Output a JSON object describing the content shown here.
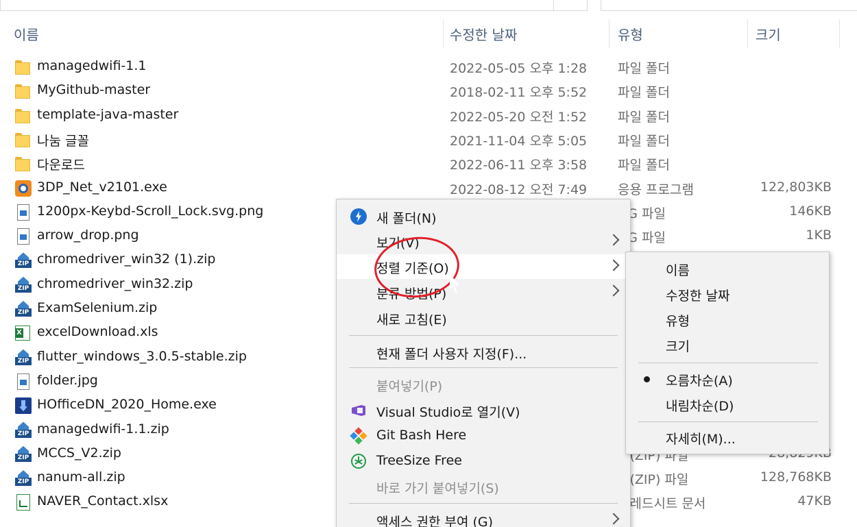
{
  "columns": {
    "name": "이름",
    "date": "수정한 날짜",
    "type": "유형",
    "size": "크기"
  },
  "files": [
    {
      "icon": "folder-icon",
      "name": "managedwifi-1.1",
      "date": "2022-05-05 오후 1:28",
      "type": "파일 폴더",
      "size": ""
    },
    {
      "icon": "folder-icon",
      "name": "MyGithub-master",
      "date": "2018-02-11 오후 5:52",
      "type": "파일 폴더",
      "size": ""
    },
    {
      "icon": "folder-icon",
      "name": "template-java-master",
      "date": "2022-05-20 오전 1:52",
      "type": "파일 폴더",
      "size": ""
    },
    {
      "icon": "folder-icon",
      "name": "나눔 글꼴",
      "date": "2021-11-04 오후 5:05",
      "type": "파일 폴더",
      "size": ""
    },
    {
      "icon": "folder-icon",
      "name": "다운로드",
      "date": "2022-06-11 오후 3:58",
      "type": "파일 폴더",
      "size": ""
    },
    {
      "icon": "exe-3dp-icon",
      "name": "3DP_Net_v2101.exe",
      "date": "2022-08-12 오전 7:49",
      "type": "응용 프로그램",
      "size": "122,803KB"
    },
    {
      "icon": "png-file-icon",
      "name": "1200px-Keybd-Scroll_Lock.svg.png",
      "date": "",
      "type": "NG 파일",
      "size": "146KB"
    },
    {
      "icon": "png-file-icon",
      "name": "arrow_drop.png",
      "date": "",
      "type": "NG 파일",
      "size": "1KB"
    },
    {
      "icon": "zip-file-icon",
      "name": "chromedriver_win32 (1).zip",
      "date": "",
      "type": "",
      "size": ""
    },
    {
      "icon": "zip-file-icon",
      "name": "chromedriver_win32.zip",
      "date": "",
      "type": "",
      "size": ""
    },
    {
      "icon": "zip-file-icon",
      "name": "ExamSelenium.zip",
      "date": "",
      "type": "",
      "size": ""
    },
    {
      "icon": "xls-file-icon",
      "name": "excelDownload.xls",
      "date": "",
      "type": "",
      "size": ""
    },
    {
      "icon": "zip-file-icon",
      "name": "flutter_windows_3.0.5-stable.zip",
      "date": "",
      "type": "",
      "size": ""
    },
    {
      "icon": "jpg-file-icon",
      "name": "folder.jpg",
      "date": "",
      "type": "",
      "size": ""
    },
    {
      "icon": "hoffice-installer-icon",
      "name": "HOfficeDN_2020_Home.exe",
      "date": "",
      "type": "",
      "size": ""
    },
    {
      "icon": "zip-file-icon",
      "name": "managedwifi-1.1.zip",
      "date": "",
      "type": "",
      "size": ""
    },
    {
      "icon": "zip-file-icon",
      "name": "MCCS_V2.zip",
      "date": "",
      "type": "축(ZIP) 파일",
      "size": "28,829KB"
    },
    {
      "icon": "zip-file-icon",
      "name": "nanum-all.zip",
      "date": "",
      "type": "축(ZIP) 파일",
      "size": "128,768KB"
    },
    {
      "icon": "xlsx-file-icon",
      "name": "NAVER_Contact.xlsx",
      "date": "",
      "type": "프레드시트 문서",
      "size": "47KB"
    }
  ],
  "context_menu": {
    "items": [
      {
        "key": "new-folder",
        "label": "새 폴더(N)",
        "icon": "new-folder-icon",
        "submenu": false,
        "disabled": false
      },
      {
        "key": "view",
        "label": "보기(V)",
        "icon": "",
        "submenu": true,
        "disabled": false
      },
      {
        "key": "sort-by",
        "label": "정렬 기준(O)",
        "icon": "",
        "submenu": true,
        "disabled": false,
        "highlighted": true
      },
      {
        "key": "group-by",
        "label": "분류 방법(P)",
        "icon": "",
        "submenu": true,
        "disabled": false
      },
      {
        "key": "refresh",
        "label": "새로 고침(E)",
        "icon": "",
        "submenu": false,
        "disabled": false
      },
      {
        "key": "customize",
        "label": "현재 폴더 사용자 지정(F)...",
        "icon": "",
        "submenu": false,
        "disabled": false
      },
      {
        "key": "paste",
        "label": "붙여넣기(P)",
        "icon": "",
        "submenu": false,
        "disabled": true
      },
      {
        "key": "open-vs",
        "label": "Visual Studio로 열기(V)",
        "icon": "visual-studio-icon",
        "submenu": false,
        "disabled": false
      },
      {
        "key": "git-bash",
        "label": "Git Bash Here",
        "icon": "git-bash-icon",
        "submenu": false,
        "disabled": false
      },
      {
        "key": "treesize",
        "label": "TreeSize Free",
        "icon": "treesize-icon",
        "submenu": false,
        "disabled": false
      },
      {
        "key": "paste-shortcut",
        "label": "바로 가기 붙여넣기(S)",
        "icon": "",
        "submenu": false,
        "disabled": true
      },
      {
        "key": "grant-access",
        "label": "액세스 권한 부여 (G)",
        "icon": "",
        "submenu": true,
        "disabled": false
      }
    ]
  },
  "sort_submenu": {
    "items": [
      {
        "label": "이름",
        "selected": false
      },
      {
        "label": "수정한 날짜",
        "selected": false
      },
      {
        "label": "유형",
        "selected": false
      },
      {
        "label": "크기",
        "selected": false
      },
      {
        "label": "오름차순(A)",
        "selected": true
      },
      {
        "label": "내림차순(D)",
        "selected": false
      },
      {
        "label": "자세히(M)...",
        "selected": false
      }
    ]
  },
  "colors": {
    "folder": "#ffd45e",
    "annotation": "#e0202a",
    "header_text": "#4c607a",
    "menu_bg": "#f2f2f2"
  }
}
